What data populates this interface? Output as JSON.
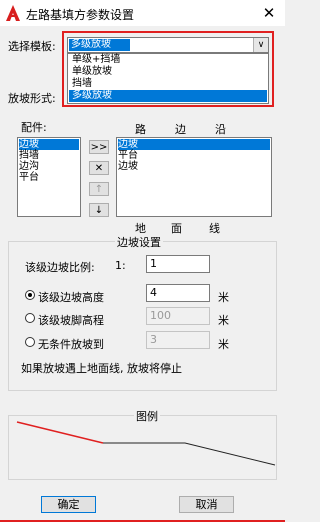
{
  "window": {
    "title": "左路基填方参数设置",
    "close_glyph": "✕"
  },
  "template": {
    "label": "选择模板:",
    "selected": "多级放坡",
    "options": [
      {
        "label": "单级+挡墙",
        "selected": false
      },
      {
        "label": "单级放坡",
        "selected": false
      },
      {
        "label": "挡墙",
        "selected": false
      },
      {
        "label": "多级放坡",
        "selected": true
      }
    ]
  },
  "slope_form": {
    "label": "放坡形式:"
  },
  "components": {
    "label": "配件:",
    "items": [
      {
        "label": "边坡",
        "selected": true
      },
      {
        "label": "挡墙",
        "selected": false
      },
      {
        "label": "边沟",
        "selected": false
      },
      {
        "label": "平台",
        "selected": false
      }
    ]
  },
  "move_buttons": {
    "add": ">>",
    "remove": "✕",
    "up": "↑",
    "down": "↓"
  },
  "path": {
    "header": [
      "路",
      "边",
      "沿"
    ],
    "footer": [
      "地",
      "面",
      "线"
    ],
    "items": [
      {
        "label": "边坡",
        "selected": true
      },
      {
        "label": "平台",
        "selected": false
      },
      {
        "label": "边坡",
        "selected": false
      }
    ]
  },
  "slope_settings": {
    "title": "边坡设置",
    "ratio_label": "该级边坡比例:",
    "ratio_prefix": "1:",
    "ratio_value": "1",
    "height_label": "该级边坡高度",
    "height_value": "4",
    "height_unit": "米",
    "toe_label": "该级坡脚高程",
    "toe_value": "100",
    "toe_unit": "米",
    "unconditional_label": "无条件放坡到",
    "unconditional_value": "3",
    "unconditional_unit": "米",
    "selected_option": "height",
    "note": "如果放坡遇上地面线, 放坡将停止"
  },
  "legend": {
    "title": "图例",
    "colors": {
      "slope": "#e02020",
      "ground": "#222222"
    }
  },
  "buttons": {
    "ok": "确定",
    "cancel": "取消"
  },
  "colors": {
    "accent": "#0078d7",
    "highlight": "#e02020"
  }
}
